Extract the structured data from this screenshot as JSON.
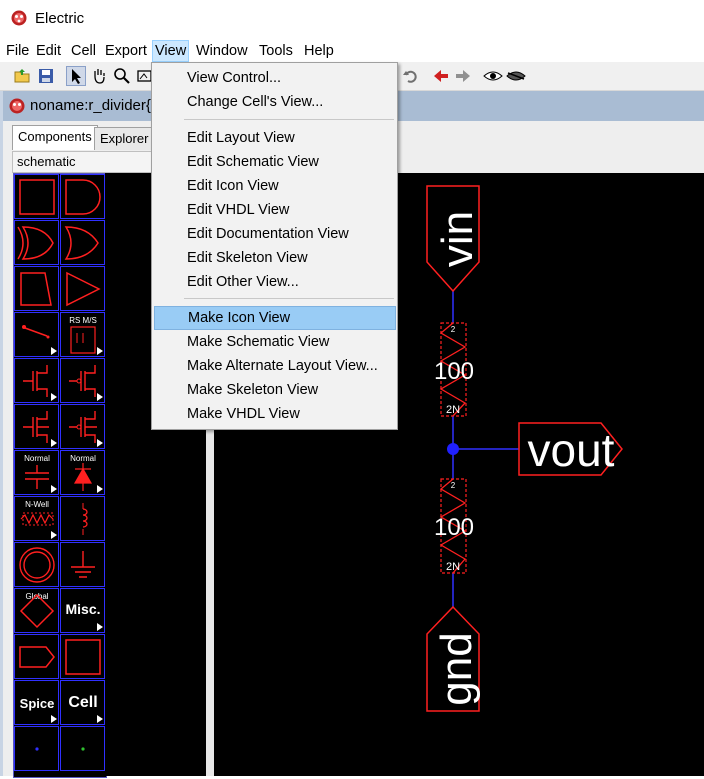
{
  "window": {
    "title": "Electric",
    "icon": "electric-bug-icon"
  },
  "menubar": {
    "items": [
      "File",
      "Edit",
      "Cell",
      "Export",
      "View",
      "Window",
      "Tools",
      "Help"
    ],
    "active": "View"
  },
  "toolbar": {
    "icons": [
      "open-folder-icon",
      "save-icon",
      "select-arrow-icon",
      "pan-hand-icon",
      "zoom-icon",
      "outline-icon",
      "undo-icon",
      "back-arrow-icon",
      "forward-arrow-icon",
      "eye-icon",
      "eye-closed-icon"
    ]
  },
  "cell_window": {
    "title": "noname:r_divider{s"
  },
  "left_panel": {
    "tabs": [
      "Components",
      "Explorer"
    ],
    "technology": "schematic",
    "palette_labels": {
      "rs_ms": "RS M/S",
      "normal_a": "Normal",
      "normal_b": "Normal",
      "nwell": "N-Well",
      "global": "Global",
      "misc": "Misc.",
      "spice": "Spice",
      "cell": "Cell"
    }
  },
  "view_menu": {
    "group1": [
      "View Control...",
      "Change Cell's View..."
    ],
    "group2": [
      "Edit Layout View",
      "Edit Schematic View",
      "Edit Icon View",
      "Edit VHDL View",
      "Edit Documentation View",
      "Edit Skeleton View",
      "Edit Other View..."
    ],
    "group3": [
      "Make Icon View",
      "Make Schematic View",
      "Make Alternate Layout View...",
      "Make Skeleton View",
      "Make VHDL View"
    ],
    "highlighted": "Make Icon View"
  },
  "schematic": {
    "export_vin": "vin",
    "export_vout": "vout",
    "export_gnd": "gnd",
    "resistor_top_value": "100",
    "resistor_bottom_value": "100",
    "pin_label_2": "2",
    "pin_label_2n": "2N",
    "colors": {
      "wire": "#3030ff",
      "component": "#ff2020",
      "text": "#ffffff",
      "background": "#000000"
    }
  }
}
